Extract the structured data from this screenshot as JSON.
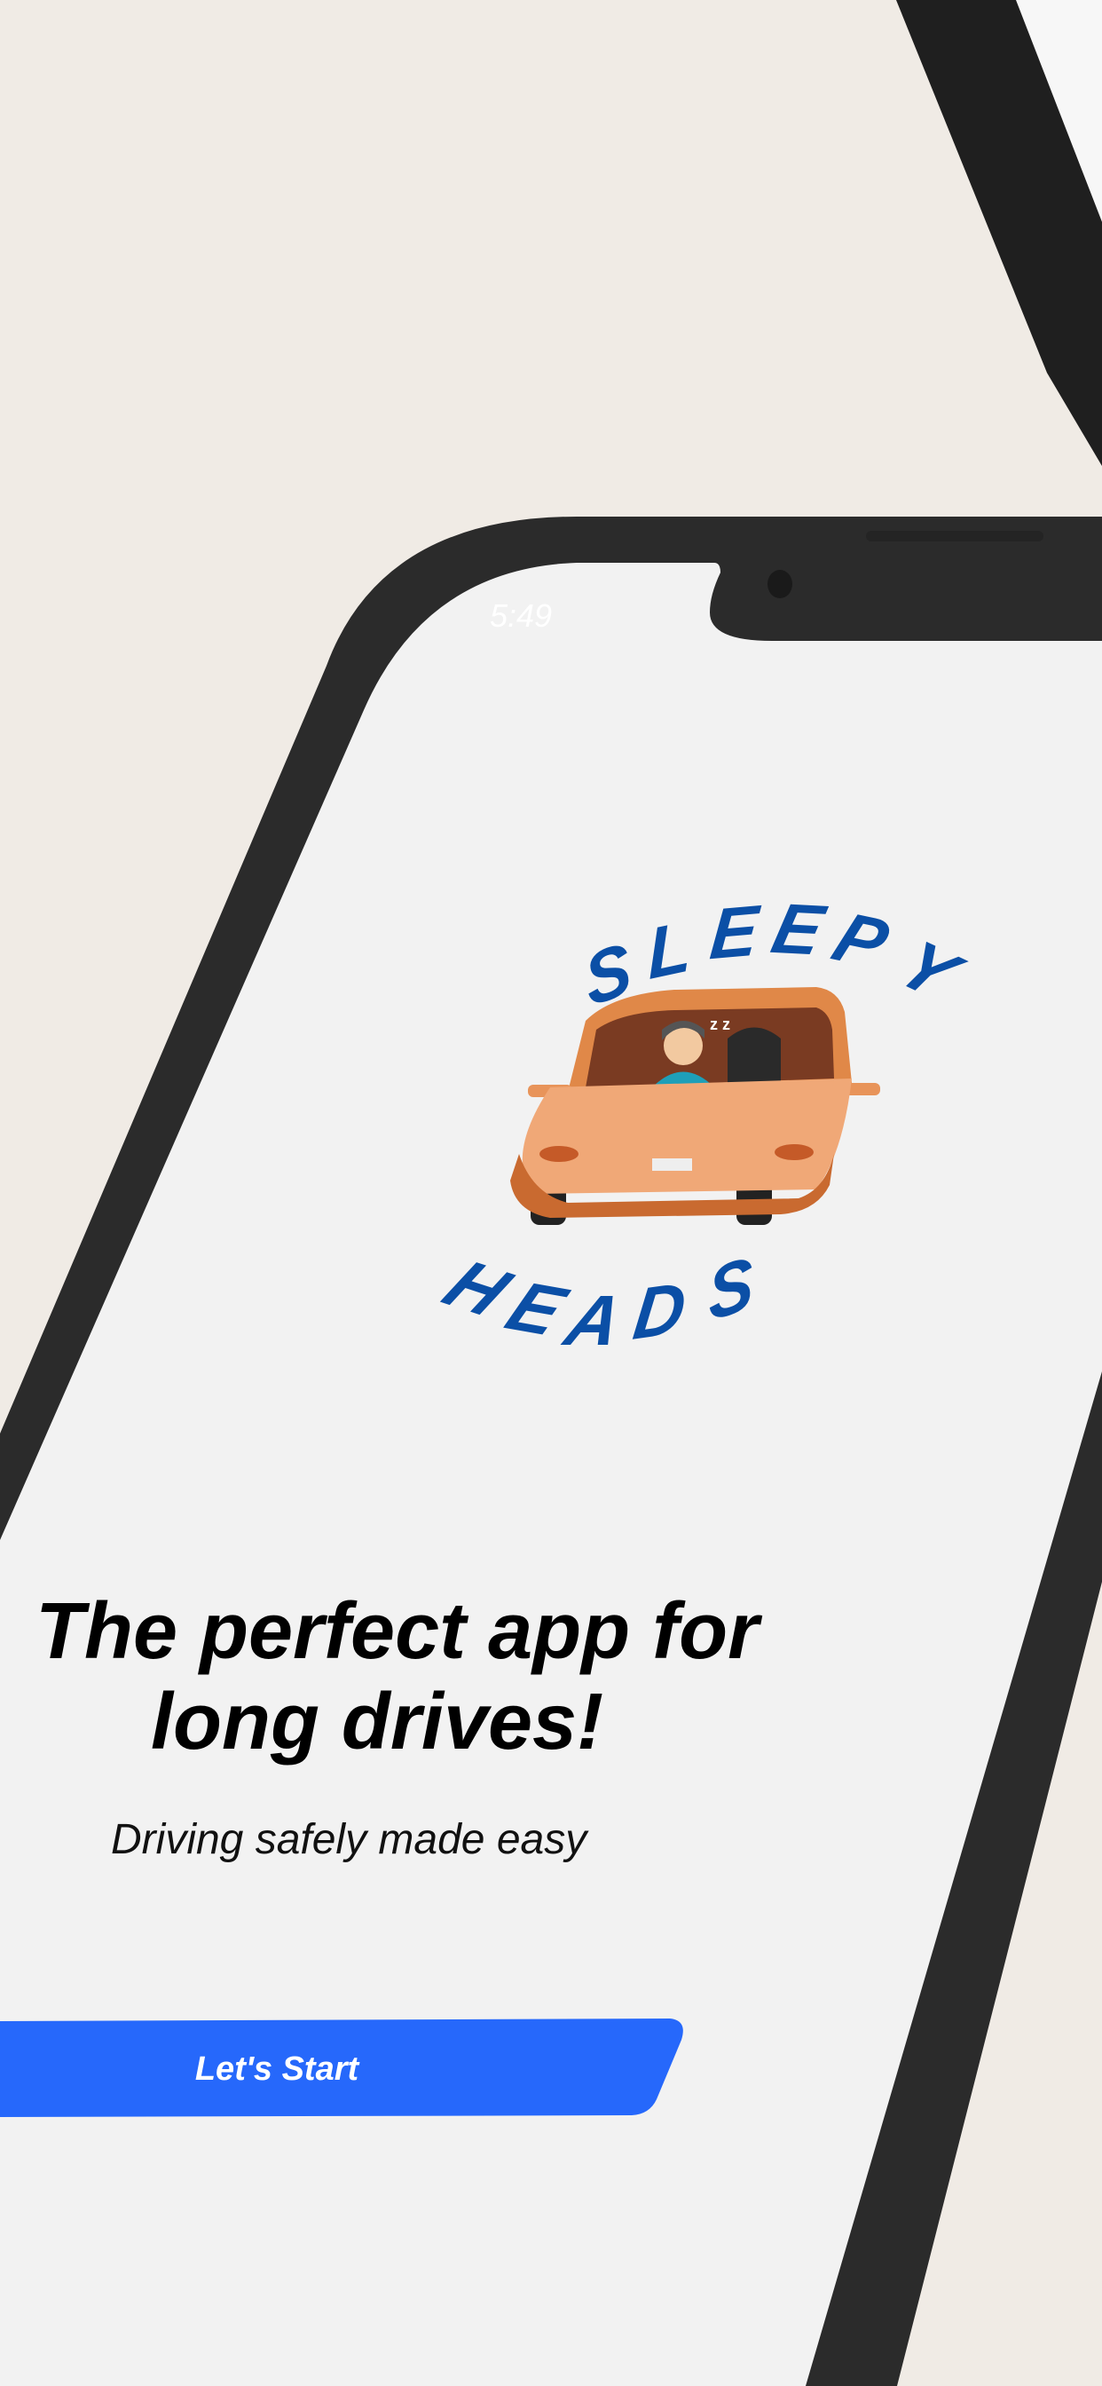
{
  "status_bar": {
    "time": "5:49"
  },
  "logo": {
    "top_word_letters": [
      "S",
      "L",
      "E",
      "E",
      "P",
      "Y"
    ],
    "bottom_word_letters": [
      "H",
      "E",
      "A",
      "D",
      "S"
    ],
    "text": "SLEEPY HEADS",
    "icon": "car-with-sleeping-driver-icon"
  },
  "hero": {
    "title_line1": "The perfect app for",
    "title_line2": "long drives!",
    "subtitle": "Driving safely made easy"
  },
  "cta": {
    "label": "Let's Start"
  },
  "colors": {
    "background": "#f0ebe5",
    "phone_body": "#2b2b2b",
    "screen": "#f2f2f2",
    "logo_blue": "#0b4fa6",
    "car_orange": "#e8945a",
    "button": "#2668fb"
  }
}
